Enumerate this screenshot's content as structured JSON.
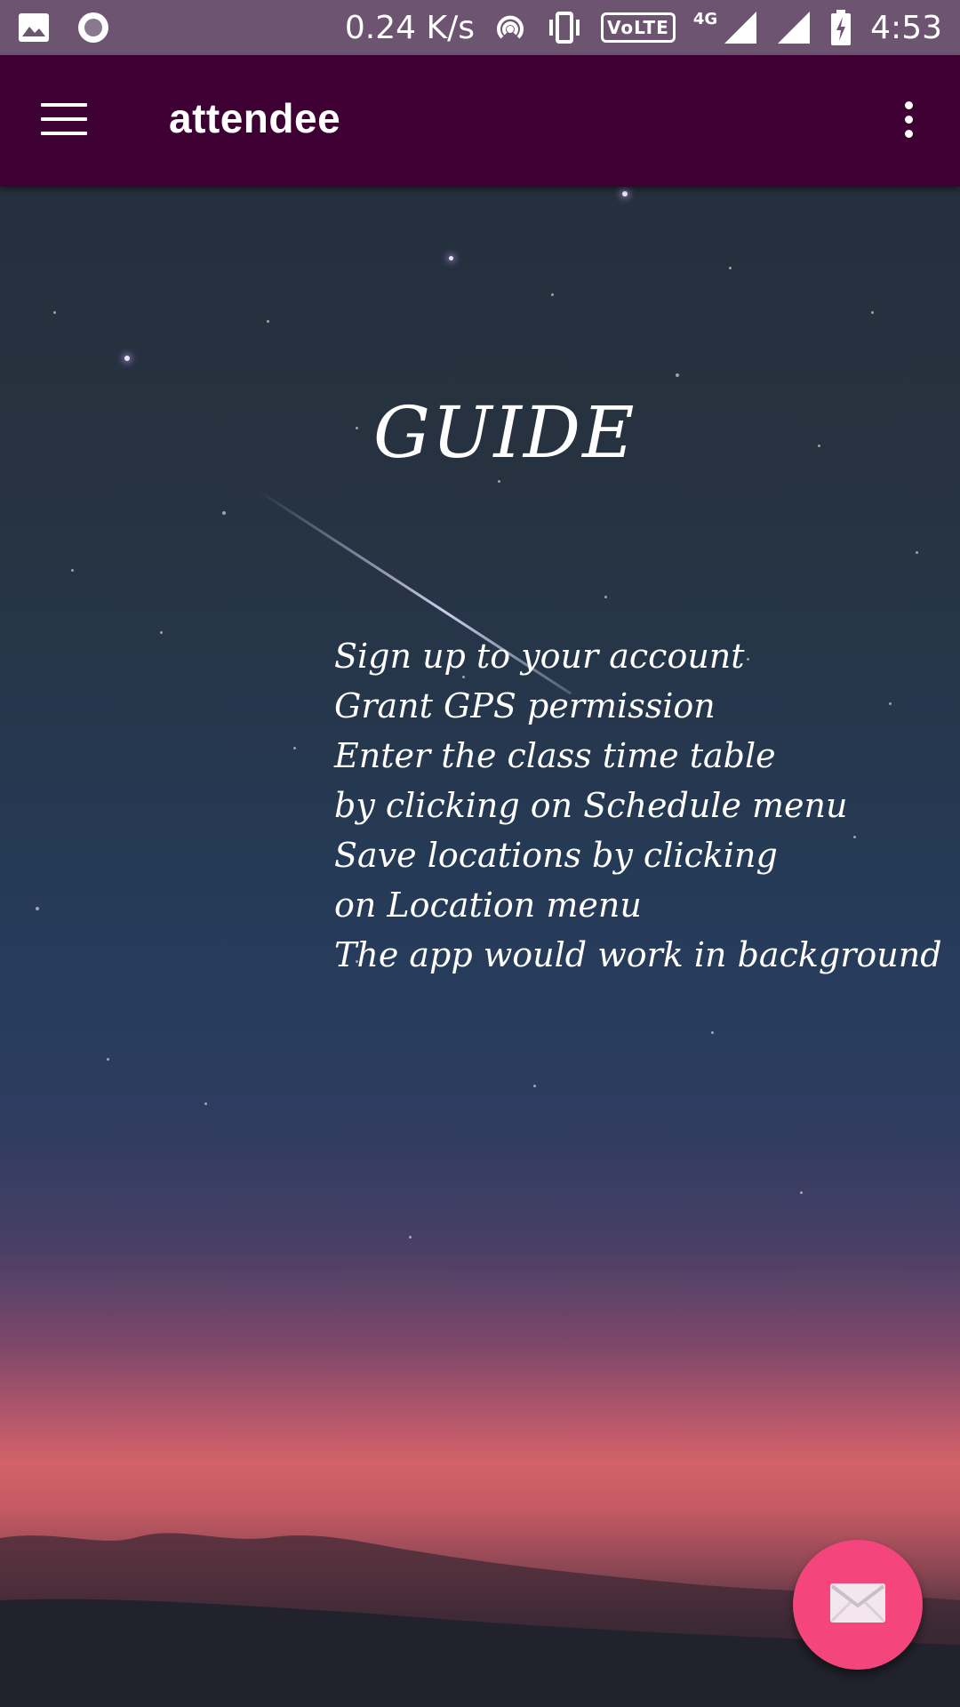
{
  "status_bar": {
    "net_speed": "0.24 K/s",
    "volte": "VoLTE",
    "network": "4G",
    "time": "4:53"
  },
  "app_bar": {
    "title": "attendee"
  },
  "guide": {
    "title": "GUIDE",
    "lines": [
      "Sign up to your account",
      "Grant GPS permission",
      "Enter the class time table",
      "by clicking on Schedule menu",
      "Save locations by clicking",
      "on Location menu",
      "The app would work in background"
    ]
  },
  "colors": {
    "status_bar": "#6d5470",
    "app_bar": "#3e0033",
    "fab": "#f5457d"
  },
  "icons": {
    "menu": "hamburger-menu-icon",
    "overflow": "more-vert-icon",
    "fab": "mail-icon"
  }
}
